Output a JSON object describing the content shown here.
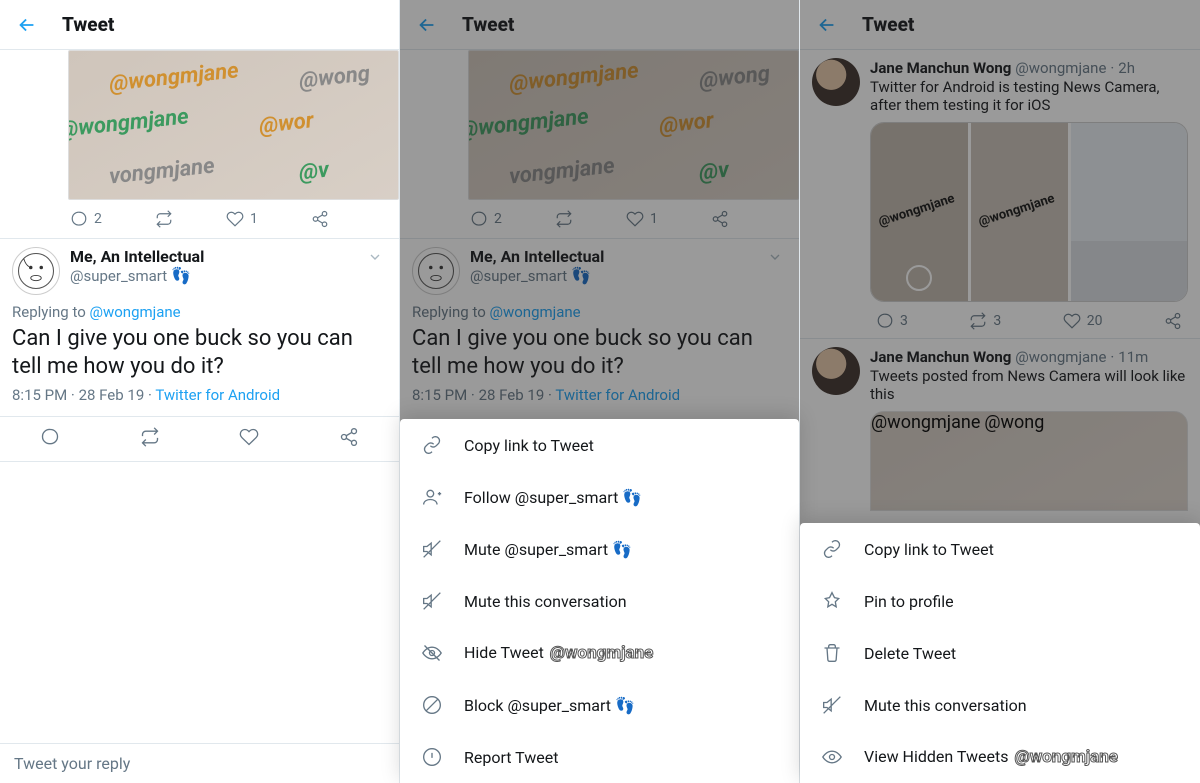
{
  "header_title": "Tweet",
  "reply_placeholder": "Tweet your reply",
  "preview_acts": {
    "replies": "2",
    "likes": "1"
  },
  "tweet": {
    "display_name": "Me, An Intellectual",
    "handle": "@super_smart",
    "emoji": "👣",
    "replying_label": "Replying to ",
    "replying_to": "@wongmjane",
    "body": "Can I give you one buck so you can tell me how you do it?",
    "time": "8:15 PM",
    "date": "28 Feb 19",
    "source": "Twitter for Android"
  },
  "sheet_a": {
    "copy": "Copy link to Tweet",
    "follow": "Follow @super_smart",
    "mute_user": "Mute @super_smart",
    "mute_convo": "Mute this conversation",
    "hide": "Hide Tweet",
    "block": "Block @super_smart",
    "report": "Report Tweet",
    "follow_emoji": "👣",
    "mute_emoji": "👣",
    "block_emoji": "👣",
    "watermark": "@wongmjane"
  },
  "timeline": {
    "item1": {
      "name": "Jane Manchun Wong",
      "handle": "@wongmjane",
      "age": "2h",
      "body": "Twitter for Android is testing News Camera, after them testing it for iOS",
      "replies": "3",
      "retweets": "3",
      "likes": "20",
      "wm": "@wongmjane"
    },
    "item2": {
      "name": "Jane Manchun Wong",
      "handle": "@wongmjane",
      "age": "11m",
      "body": "Tweets posted from News Camera will look like this",
      "img_text_a": "@wongmjane",
      "img_text_b": "@wong"
    }
  },
  "sheet_b": {
    "copy": "Copy link to Tweet",
    "pin": "Pin to profile",
    "delete": "Delete Tweet",
    "mute": "Mute this conversation",
    "view_hidden": "View Hidden Tweets",
    "watermark": "@wongmjane"
  }
}
